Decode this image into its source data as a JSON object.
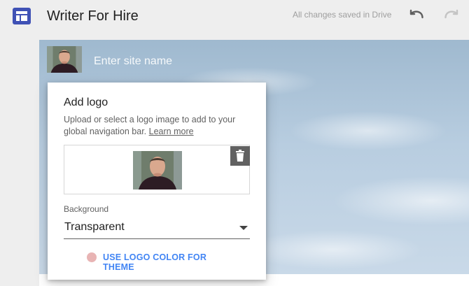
{
  "header": {
    "title": "Writer For Hire",
    "save_status": "All changes saved in Drive",
    "app_icon": "sites-layout-icon",
    "undo_icon": "undo-icon",
    "redo_icon": "redo-icon"
  },
  "site_header": {
    "site_name_placeholder": "Enter site name",
    "site_name_value": ""
  },
  "add_logo_dialog": {
    "title": "Add logo",
    "description": "Upload or select a logo image to add to your global navigation bar.",
    "learn_more": "Learn more",
    "delete_icon": "trash-icon",
    "background_label": "Background",
    "background_value": "Transparent",
    "use_logo_color_label": "USE LOGO COLOR FOR THEME"
  },
  "colors": {
    "app_icon": "#3f51b5",
    "link_blue": "#4285f4",
    "logo_color_swatch": "#e8b4b4"
  }
}
